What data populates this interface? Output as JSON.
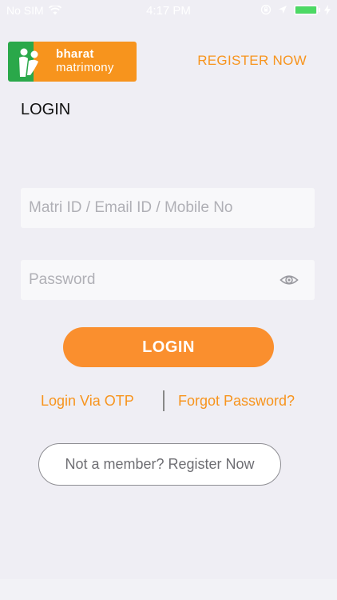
{
  "status_bar": {
    "carrier": "No SIM",
    "time": "4:17 PM"
  },
  "header": {
    "logo_line1": "bharat",
    "logo_line2": "matrimony",
    "register_link": "REGISTER NOW"
  },
  "page_title": "LOGIN",
  "form": {
    "id_placeholder": "Matri ID / Email ID / Mobile No",
    "id_value": "",
    "password_placeholder": "Password",
    "password_value": "",
    "login_button": "LOGIN"
  },
  "links": {
    "otp": "Login Via OTP",
    "forgot": "Forgot Password?"
  },
  "register_button": "Not a member? Register Now",
  "colors": {
    "brand_orange": "#f7941d",
    "brand_green": "#2aa84a",
    "background": "#efeef4"
  },
  "icons": {
    "wifi": "wifi-icon",
    "location": "location-arrow-icon",
    "lock_rotation": "rotation-lock-icon",
    "battery": "battery-icon",
    "charging": "charging-bolt-icon",
    "eye": "eye-icon"
  }
}
